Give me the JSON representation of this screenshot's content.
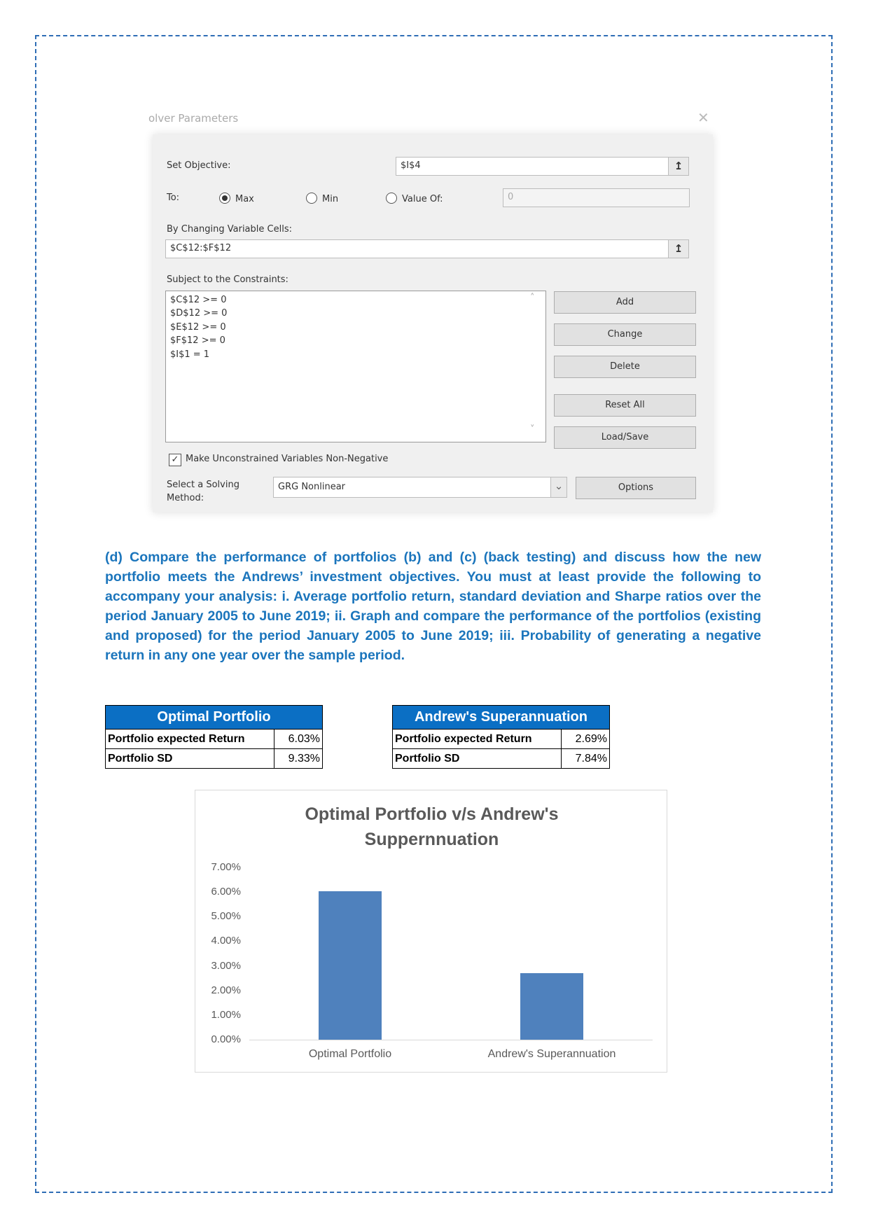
{
  "dialog": {
    "title": "olver Parameters",
    "set_objective_label": "Set Objective:",
    "set_objective_value": "$I$4",
    "to_label": "To:",
    "options": [
      {
        "label": "Max",
        "selected": true
      },
      {
        "label": "Min",
        "selected": false
      },
      {
        "label": "Value Of:",
        "selected": false
      }
    ],
    "value_of": "0",
    "changing_label": "By Changing Variable Cells:",
    "changing_value": "$C$12:$F$12",
    "constraints_label": "Subject to the Constraints:",
    "constraints": [
      "$C$12 >= 0",
      "$D$12 >= 0",
      "$E$12 >= 0",
      "$F$12 >= 0",
      "$I$1 = 1"
    ],
    "buttons": [
      "Add",
      "Change",
      "Delete",
      "Reset All",
      "Load/Save"
    ],
    "checkbox_label": "Make Unconstrained Variables Non-Negative",
    "checkbox_checked": true,
    "method_label_1": "Select a Solving",
    "method_label_2": "Method:",
    "method_value": "GRG Nonlinear",
    "options_button": "Options"
  },
  "paragraph": "(d) Compare the performance of portfolios (b) and (c) (back testing) and discuss how the new portfolio meets the Andrews’ investment objectives. You must at least provide the following to accompany your analysis:  i. Average portfolio return, standard deviation and Sharpe ratios over the period January 2005 to June 2019; ii. Graph and compare the performance of the portfolios (existing and proposed) for the period January 2005 to June 2019; iii. Probability of generating a negative return in any one year over the sample period.",
  "tables": [
    {
      "title": "Optimal Portfolio",
      "rows": [
        [
          "Portfolio expected Return",
          "6.03%"
        ],
        [
          "Portfolio SD",
          "9.33%"
        ]
      ]
    },
    {
      "title": "Andrew's Superannuation",
      "rows": [
        [
          "Portfolio expected Return",
          "2.69%"
        ],
        [
          "Portfolio SD",
          "7.84%"
        ]
      ]
    }
  ],
  "chart_data": {
    "type": "bar",
    "title_line1": "Optimal Portfolio v/s Andrew's",
    "title_line2": "Suppernnuation",
    "categories": [
      "Optimal Portfolio",
      "Andrew's Superannuation"
    ],
    "values": [
      6.03,
      2.69
    ],
    "ylim": [
      0,
      7
    ],
    "yticks": [
      "0.00%",
      "1.00%",
      "2.00%",
      "3.00%",
      "4.00%",
      "5.00%",
      "6.00%",
      "7.00%"
    ],
    "bar_color": "#4f81bd",
    "grid": false
  }
}
